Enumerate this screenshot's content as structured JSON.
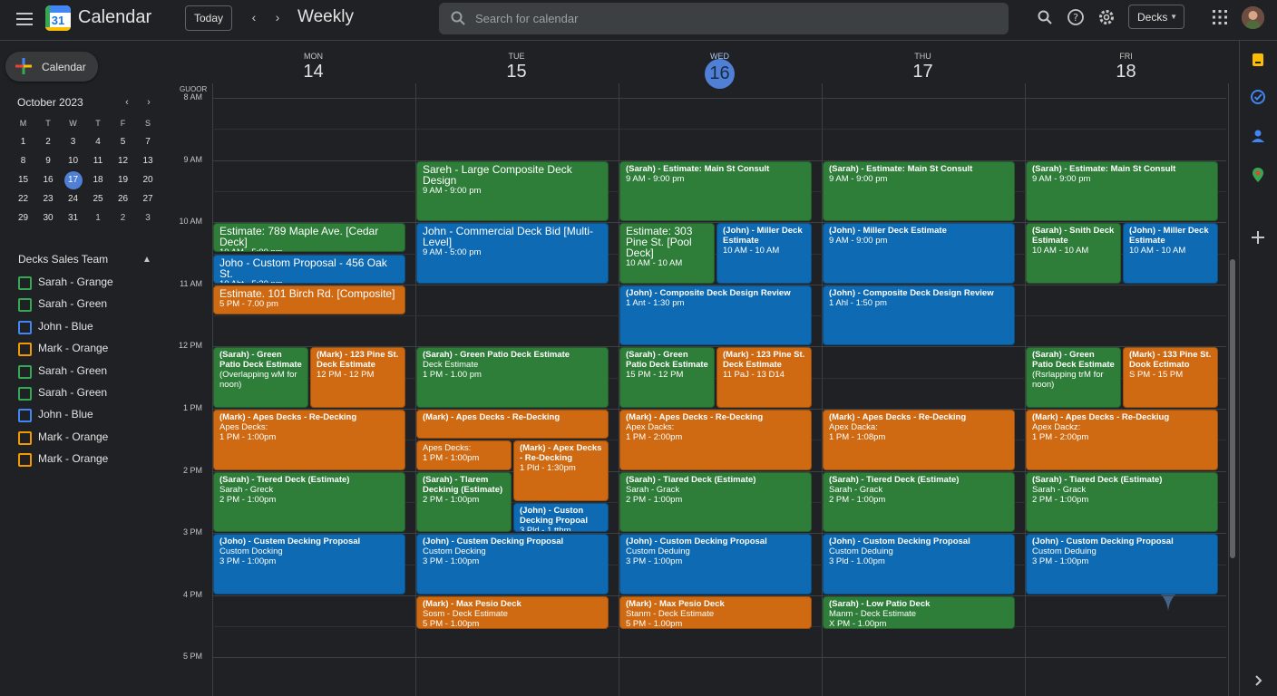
{
  "header": {
    "app_title": "Calendar",
    "logo_number": "31",
    "today_label": "Today",
    "prev_icon": "‹",
    "next_icon": "›",
    "view_title": "Weekly",
    "search_placeholder": "Search for calendar",
    "view_select": "Decks"
  },
  "sidebar": {
    "create_label": "Calendar",
    "mini_month": "October 2023",
    "mini_weekdays": [
      "M",
      "T",
      "W",
      "T",
      "F",
      "S"
    ],
    "mini_weeks": [
      [
        "1",
        "2",
        "3",
        "4",
        "5",
        "7"
      ],
      [
        "8",
        "9",
        "10",
        "11",
        "12",
        "13"
      ],
      [
        "15",
        "16",
        "17",
        "18",
        "19",
        "20"
      ],
      [
        "22",
        "23",
        "24",
        "25",
        "26",
        "27"
      ],
      [
        "29",
        "30",
        "31",
        "1",
        "2",
        "3"
      ]
    ],
    "mini_selected": "17",
    "team_title": "Decks Sales Team",
    "team": [
      {
        "label": "Sarah - Grange",
        "color": "#34a853"
      },
      {
        "label": "Sarah - Green",
        "color": "#34a853"
      },
      {
        "label": "John - Blue",
        "color": "#4285f4"
      },
      {
        "label": "Mark - Orange",
        "color": "#f29900"
      },
      {
        "label": "Sarah - Green",
        "color": "#34a853"
      },
      {
        "label": "Sarah - Green",
        "color": "#34a853"
      },
      {
        "label": "John - Blue",
        "color": "#4285f4"
      },
      {
        "label": "Mark - Orange",
        "color": "#f29900"
      },
      {
        "label": "Mark - Orange",
        "color": "#f29900"
      }
    ]
  },
  "grid": {
    "tz_label": "GUOOR",
    "days": [
      {
        "dow": "MON",
        "num": "14",
        "today": false
      },
      {
        "dow": "TUE",
        "num": "15",
        "today": false
      },
      {
        "dow": "WED",
        "num": "16",
        "today": true
      },
      {
        "dow": "THU",
        "num": "17",
        "today": false
      },
      {
        "dow": "FRI",
        "num": "18",
        "today": false
      }
    ],
    "hours": [
      "8 AM",
      "9 AM",
      "10 AM",
      "11 AM",
      "12 PM",
      "1 PM",
      "2 PM",
      "3 PM",
      "4 PM",
      "5 PM"
    ]
  },
  "events": [
    {
      "day": 0,
      "start": 10,
      "end": 10.5,
      "col": 0,
      "cols": 1,
      "color": "green",
      "big": true,
      "title": "Estimate: 789 Maple Ave. [Cedar Deck]",
      "lines": [
        "10 AM - 5:00 pm"
      ]
    },
    {
      "day": 0,
      "start": 10.5,
      "end": 11,
      "col": 0,
      "cols": 1,
      "color": "blue",
      "big": true,
      "title": "Joho - Custom Proposal - 456 Oak St.",
      "lines": [
        "10 Abt - 5:30 pm"
      ]
    },
    {
      "day": 0,
      "start": 11,
      "end": 11.5,
      "col": 0,
      "cols": 1,
      "color": "orange",
      "big": true,
      "title": "Estimate. 101 Birch Rd. [Composite]",
      "lines": [
        "5 PM - 7.00 pm"
      ]
    },
    {
      "day": 0,
      "start": 12,
      "end": 13,
      "col": 0,
      "cols": 2,
      "color": "green",
      "title": "(Sarah) - Green Patio Deck Estimate",
      "lines": [
        "(Overlapping wM for noon)"
      ]
    },
    {
      "day": 0,
      "start": 12,
      "end": 13,
      "col": 1,
      "cols": 2,
      "color": "orange",
      "title": "(Mark) - 123 Pine St. Deck Estimate",
      "lines": [
        "12 PM - 12 PM"
      ]
    },
    {
      "day": 0,
      "start": 13,
      "end": 14,
      "col": 0,
      "cols": 1,
      "color": "orange",
      "title": "(Mark) - Apes Decks - Re-Decking",
      "lines": [
        "Apes Decks:",
        "1 PM - 1:00pm"
      ]
    },
    {
      "day": 0,
      "start": 14,
      "end": 15,
      "col": 0,
      "cols": 1,
      "color": "green",
      "title": "(Sarah) - Tiered Deck (Estimate)",
      "lines": [
        "Sarah - Greck",
        "2 PM - 1:00pm"
      ]
    },
    {
      "day": 0,
      "start": 15,
      "end": 16,
      "col": 0,
      "cols": 1,
      "color": "blue",
      "title": "(Joho) - Custem Decking Proposal",
      "lines": [
        "Custom Docking",
        "3 PM - 1:00pm"
      ]
    },
    {
      "day": 1,
      "start": 9,
      "end": 10,
      "col": 0,
      "cols": 1,
      "color": "green",
      "big": true,
      "title": "Sareh - Large Composite Deck Design",
      "lines": [
        "9 AM - 9:00 pm"
      ]
    },
    {
      "day": 1,
      "start": 10,
      "end": 11,
      "col": 0,
      "cols": 1,
      "color": "blue",
      "big": true,
      "title": "John - Commercial Deck Bid [Multi-Level]",
      "lines": [
        "9 AM - 5:00 pm"
      ]
    },
    {
      "day": 1,
      "start": 12,
      "end": 13,
      "col": 0,
      "cols": 1,
      "color": "green",
      "title": "(Sarah) - Green Patio Deck Estimate",
      "lines": [
        "Deck Estimate",
        "1 PM - 1.00 pm"
      ]
    },
    {
      "day": 1,
      "start": 13,
      "end": 13.5,
      "col": 0,
      "cols": 1,
      "color": "orange",
      "title": "(Mark) - Apes Decks - Re-Decking",
      "lines": []
    },
    {
      "day": 1,
      "start": 13.5,
      "end": 14,
      "col": 0,
      "cols": 2,
      "color": "orange",
      "title": "",
      "lines": [
        "Apes Decks:",
        "1 PM - 1:00pm"
      ]
    },
    {
      "day": 1,
      "start": 13.5,
      "end": 14.5,
      "col": 1,
      "cols": 2,
      "color": "orange",
      "title": "(Mark) - Apex Decks - Re-Decking",
      "lines": [
        "1 Pld - 1:30pm"
      ]
    },
    {
      "day": 1,
      "start": 14,
      "end": 15,
      "col": 0,
      "cols": 2,
      "color": "green",
      "title": "(Sarah) - Tlarem Deckinig (Estimate)",
      "lines": [
        "2 PM - 1:00pm"
      ]
    },
    {
      "day": 1,
      "start": 14.5,
      "end": 15,
      "col": 1,
      "cols": 2,
      "color": "blue",
      "title": "(John) - Custon Decking Propoal",
      "lines": [
        "3 Pld - 1 tthm"
      ]
    },
    {
      "day": 1,
      "start": 15,
      "end": 16,
      "col": 0,
      "cols": 1,
      "color": "blue",
      "title": "(John) - Custem Decking Proposal",
      "lines": [
        "Custom Decking",
        "3 PM - 1:00pm"
      ]
    },
    {
      "day": 1,
      "start": 16,
      "end": 16.55,
      "col": 0,
      "cols": 1,
      "color": "orange",
      "title": "(Mark) - Max Pesio Deck",
      "lines": [
        "Sosm - Deck Estimate",
        "5 PM - 1.00pm"
      ]
    },
    {
      "day": 2,
      "start": 9,
      "end": 10,
      "col": 0,
      "cols": 1,
      "color": "green",
      "title": "(Sarah) - Estimate: Main St Consult",
      "lines": [
        "9 AM - 9:00 pm"
      ]
    },
    {
      "day": 2,
      "start": 10,
      "end": 11,
      "col": 0,
      "cols": 2,
      "color": "green",
      "big": true,
      "title": "Estimate: 303 Pine St. [Pool Deck]",
      "lines": [
        "10 AM - 10 AM"
      ]
    },
    {
      "day": 2,
      "start": 10,
      "end": 11,
      "col": 1,
      "cols": 2,
      "color": "blue",
      "title": "(John) - Miller Deck Estimate",
      "lines": [
        "10 AM - 10 AM"
      ]
    },
    {
      "day": 2,
      "start": 11,
      "end": 12,
      "col": 0,
      "cols": 1,
      "color": "blue",
      "title": "(John) - Composite Deck Design Review",
      "lines": [
        "1 Ant - 1:30 pm"
      ]
    },
    {
      "day": 2,
      "start": 12,
      "end": 13,
      "col": 0,
      "cols": 2,
      "color": "green",
      "title": "(Sarah) - Green Patio Deck Estimate",
      "lines": [
        "15 PM - 12 PM"
      ]
    },
    {
      "day": 2,
      "start": 12,
      "end": 13,
      "col": 1,
      "cols": 2,
      "color": "orange",
      "title": "(Mark) - 123 Pine St. Deck Estimate",
      "lines": [
        "11 PaJ - 13 D14"
      ]
    },
    {
      "day": 2,
      "start": 13,
      "end": 14,
      "col": 0,
      "cols": 1,
      "color": "orange",
      "title": "(Mark) - Apes Decks - Re-Decking",
      "lines": [
        "Apex Dacks:",
        "1 PM - 2:00pm"
      ]
    },
    {
      "day": 2,
      "start": 14,
      "end": 15,
      "col": 0,
      "cols": 1,
      "color": "green",
      "title": "(Sarah) - Tiared Deck (Estimate)",
      "lines": [
        "Sarah - Grack",
        "2 PM - 1:00pm"
      ]
    },
    {
      "day": 2,
      "start": 15,
      "end": 16,
      "col": 0,
      "cols": 1,
      "color": "blue",
      "title": "(John) - Custom Decking Proposal",
      "lines": [
        "Custom Deduing",
        "3 PM - 1:00pm"
      ]
    },
    {
      "day": 2,
      "start": 16,
      "end": 16.55,
      "col": 0,
      "cols": 1,
      "color": "orange",
      "title": "(Mark) - Max Pesio Deck",
      "lines": [
        "Stanm - Deck Estimate",
        "5 PM - 1.00pm"
      ]
    },
    {
      "day": 3,
      "start": 9,
      "end": 10,
      "col": 0,
      "cols": 1,
      "color": "green",
      "title": "(Sarah) - Estimate: Main St Consult",
      "lines": [
        "9 AM - 9:00 pm"
      ]
    },
    {
      "day": 3,
      "start": 10,
      "end": 11,
      "col": 0,
      "cols": 1,
      "color": "blue",
      "title": "(John) - Miller Deck Estimate",
      "lines": [
        "9 AM - 9:00 pm"
      ]
    },
    {
      "day": 3,
      "start": 11,
      "end": 12,
      "col": 0,
      "cols": 1,
      "color": "blue",
      "title": "(John) - Composite Deck Design Review",
      "lines": [
        "1 Ahl - 1:50 pm"
      ]
    },
    {
      "day": 3,
      "start": 13,
      "end": 14,
      "col": 0,
      "cols": 1,
      "color": "orange",
      "title": "(Mark) - Apes Decks - Re-Decking",
      "lines": [
        "Apex Dacka:",
        "1 PM - 1:08pm"
      ]
    },
    {
      "day": 3,
      "start": 14,
      "end": 15,
      "col": 0,
      "cols": 1,
      "color": "green",
      "title": "(Sarah) - Tiered Deck (Estimate)",
      "lines": [
        "Sarah - Grack",
        "2 PM - 1:00pm"
      ]
    },
    {
      "day": 3,
      "start": 15,
      "end": 16,
      "col": 0,
      "cols": 1,
      "color": "blue",
      "title": "(John) - Custom Decking Proposal",
      "lines": [
        "Custom Deduing",
        "3 Pld - 1.00pm"
      ]
    },
    {
      "day": 3,
      "start": 16,
      "end": 16.55,
      "col": 0,
      "cols": 1,
      "color": "green",
      "title": "(Sarah) - Low Patio Deck",
      "lines": [
        "Manm - Deck Estimate",
        "X PM - 1.00pm"
      ]
    },
    {
      "day": 4,
      "start": 9,
      "end": 10,
      "col": 0,
      "cols": 1,
      "color": "green",
      "title": "(Sarah) - Estimate: Main St Consult",
      "lines": [
        "9 AM - 9:00 pm"
      ]
    },
    {
      "day": 4,
      "start": 10,
      "end": 11,
      "col": 0,
      "cols": 2,
      "color": "green",
      "title": "(Sarah) - Snith Deck Estimate",
      "lines": [
        "10 AM - 10 AM"
      ]
    },
    {
      "day": 4,
      "start": 10,
      "end": 11,
      "col": 1,
      "cols": 2,
      "color": "blue",
      "title": "(John) - Miller Deck Estimate",
      "lines": [
        "10 AM - 10 AM"
      ]
    },
    {
      "day": 4,
      "start": 12,
      "end": 13,
      "col": 0,
      "cols": 2,
      "color": "green",
      "title": "(Sarah) - Green Patio Deck Estimate",
      "lines": [
        "(Rsrlapping trM for noon)"
      ]
    },
    {
      "day": 4,
      "start": 12,
      "end": 13,
      "col": 1,
      "cols": 2,
      "color": "orange",
      "title": "(Mark) - 133 Pine St. Dook Ectimato",
      "lines": [
        "S PM - 15 PM"
      ]
    },
    {
      "day": 4,
      "start": 13,
      "end": 14,
      "col": 0,
      "cols": 1,
      "color": "orange",
      "title": "(Mark) - Apes Decks - Re-Deckiug",
      "lines": [
        "Apex Dackz:",
        "1 PM - 2:00pm"
      ]
    },
    {
      "day": 4,
      "start": 14,
      "end": 15,
      "col": 0,
      "cols": 1,
      "color": "green",
      "title": "(Sarah) - Tiared Deck (Estimate)",
      "lines": [
        "Sarah - Grack",
        "2 PM - 1:00pm"
      ]
    },
    {
      "day": 4,
      "start": 15,
      "end": 16,
      "col": 0,
      "cols": 1,
      "color": "blue",
      "title": "(John) - Custom Decking Proposal",
      "lines": [
        "Custom Deduing",
        "3 PM - 1:00pm"
      ]
    }
  ],
  "colors": {
    "green": "#2e7d39",
    "blue": "#0d6ab3",
    "orange": "#cf6a12",
    "today": "#4f80d5"
  },
  "icons": [
    "menu-icon",
    "search-icon",
    "help-icon",
    "settings-icon",
    "apps-icon",
    "plus-icon",
    "keep-icon",
    "tasks-icon",
    "contacts-icon",
    "maps-icon",
    "add-icon",
    "expand-icon"
  ]
}
